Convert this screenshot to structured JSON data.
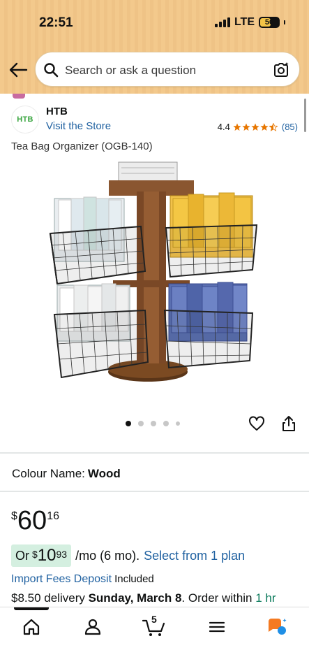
{
  "status": {
    "time": "22:51",
    "network": "LTE",
    "battery": "50"
  },
  "search": {
    "placeholder": "Search or ask a question"
  },
  "brand": {
    "logo_text": "HTB",
    "name": "HTB",
    "visit_store": "Visit the Store",
    "rating": "4.4",
    "stars": 4.5,
    "review_count": "(85)"
  },
  "product": {
    "title": "Tea Bag Organizer (OGB-140)",
    "image_count": 5,
    "active_image": 1
  },
  "colour": {
    "label": "Colour Name:",
    "value": "Wood"
  },
  "price": {
    "currency": "$",
    "whole": "60",
    "fraction": "16"
  },
  "installment": {
    "prefix": "Or",
    "currency": "$",
    "whole": "10",
    "fraction": "93",
    "per": "/mo (6 mo).",
    "link": "Select from 1 plan"
  },
  "fees": {
    "link": "Import Fees Deposit",
    "status": "Included"
  },
  "delivery": {
    "price": "$8.50",
    "text": " delivery ",
    "date": "Sunday, March 8",
    "tail": ". Order within ",
    "countdown": "1 hr"
  },
  "nav": {
    "cart_count": "5",
    "items": [
      "home",
      "account",
      "cart",
      "menu",
      "rufus"
    ]
  },
  "colors": {
    "accent_link": "#2162a1",
    "header": "#f3c98c",
    "installment_bg": "#d4efe0",
    "star": "#e77600"
  }
}
